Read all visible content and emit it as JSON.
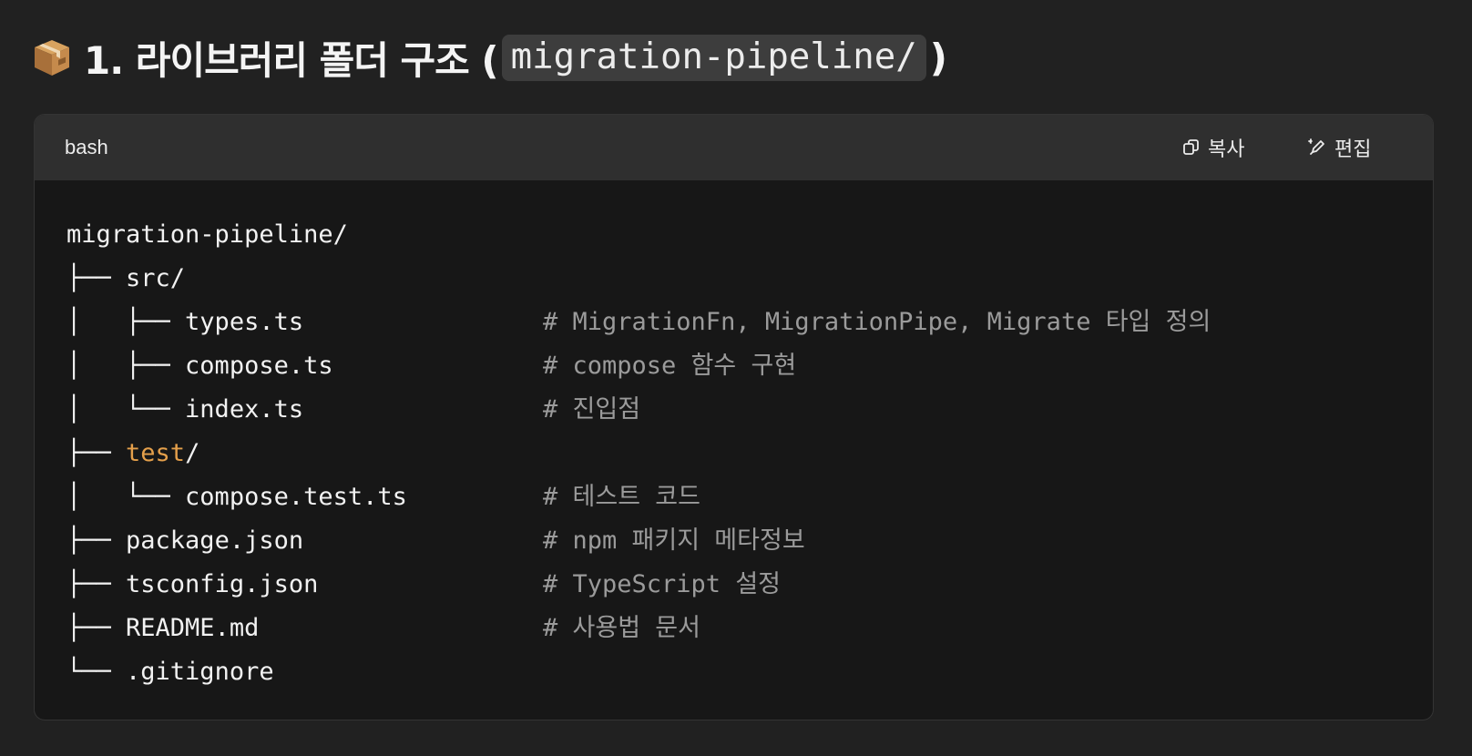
{
  "heading": {
    "emoji": "package-emoji",
    "number_title": "1. 라이브러리 폴더 구조 (",
    "inline_code": "migration-pipeline/",
    "close_paren": ")"
  },
  "code_block": {
    "language": "bash",
    "copy_label": "복사",
    "edit_label": "편집",
    "lines": [
      {
        "tree": "",
        "name": "migration-pipeline/",
        "name_kw": "",
        "suffix": "",
        "comment": ""
      },
      {
        "tree": "├── ",
        "name": "src/",
        "name_kw": "",
        "suffix": "",
        "comment": ""
      },
      {
        "tree": "│   ├── ",
        "name": "types.ts",
        "name_kw": "",
        "suffix": "",
        "comment": "# MigrationFn, MigrationPipe, Migrate 타입 정의"
      },
      {
        "tree": "│   ├── ",
        "name": "compose.ts",
        "name_kw": "",
        "suffix": "",
        "comment": "# compose 함수 구현"
      },
      {
        "tree": "│   └── ",
        "name": "index.ts",
        "name_kw": "",
        "suffix": "",
        "comment": "# 진입점"
      },
      {
        "tree": "├── ",
        "name": "",
        "name_kw": "test",
        "suffix": "/",
        "comment": ""
      },
      {
        "tree": "│   └── ",
        "name": "compose.test.ts",
        "name_kw": "",
        "suffix": "",
        "comment": "# 테스트 코드"
      },
      {
        "tree": "├── ",
        "name": "package.json",
        "name_kw": "",
        "suffix": "",
        "comment": "# npm 패키지 메타정보"
      },
      {
        "tree": "├── ",
        "name": "tsconfig.json",
        "name_kw": "",
        "suffix": "",
        "comment": "# TypeScript 설정"
      },
      {
        "tree": "├── ",
        "name": "README.md",
        "name_kw": "",
        "suffix": "",
        "comment": "# 사용법 문서"
      },
      {
        "tree": "└── ",
        "name": ".gitignore",
        "name_kw": "",
        "suffix": "",
        "comment": ""
      }
    ]
  },
  "colors": {
    "background": "#212121",
    "code_bg": "#171717",
    "header_bg": "#2f2f2f",
    "keyword": "#e5a04b",
    "comment": "#9b9b9b"
  }
}
